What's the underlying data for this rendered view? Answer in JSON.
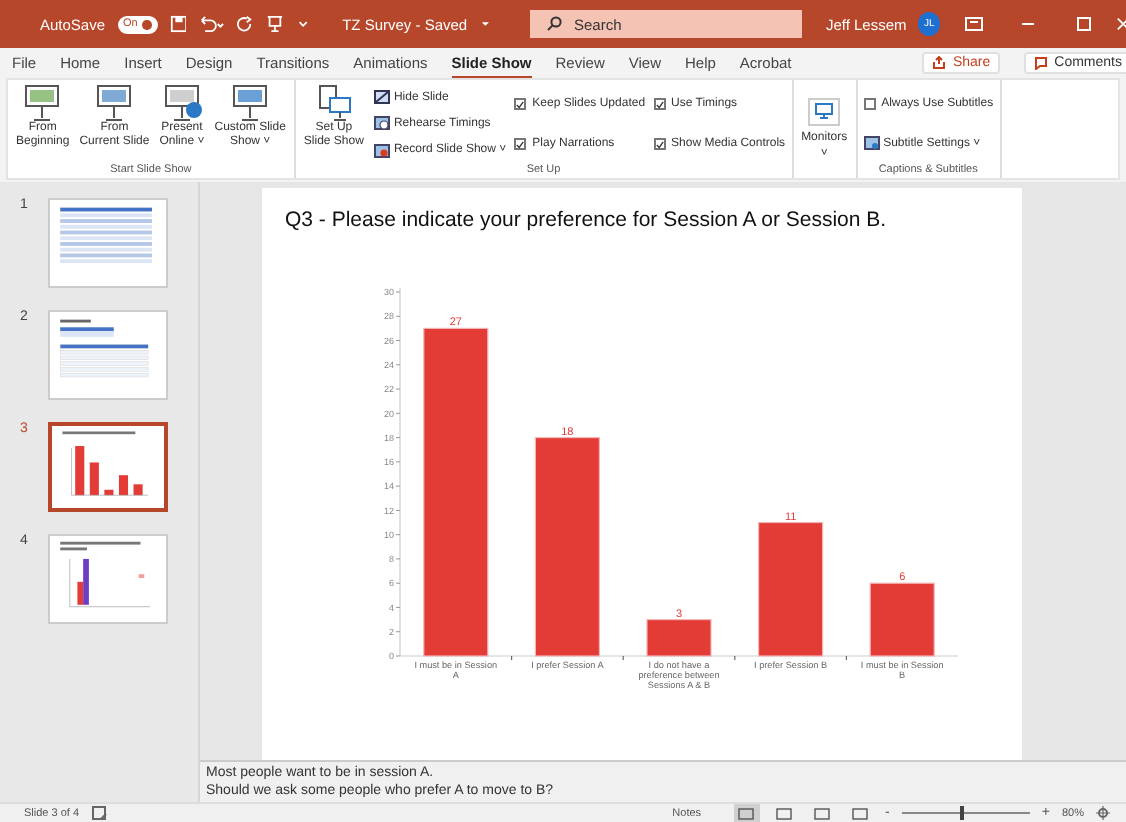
{
  "title_bar": {
    "autosave_label": "AutoSave",
    "autosave_toggle": {
      "text": "On",
      "on": true
    },
    "document_title": "TZ Survey - Saved",
    "search": {
      "placeholder": "Search"
    },
    "user_name": "Jeff Lessem",
    "avatar": "JL"
  },
  "tabs": [
    {
      "label": "File",
      "selected": false
    },
    {
      "label": "Home",
      "selected": false
    },
    {
      "label": "Insert",
      "selected": false
    },
    {
      "label": "Design",
      "selected": false
    },
    {
      "label": "Transitions",
      "selected": false
    },
    {
      "label": "Animations",
      "selected": false
    },
    {
      "label": "Slide Show",
      "selected": true
    },
    {
      "label": "Review",
      "selected": false
    },
    {
      "label": "View",
      "selected": false
    },
    {
      "label": "Help",
      "selected": false
    },
    {
      "label": "Acrobat",
      "selected": false
    }
  ],
  "tab_actions": {
    "share": "Share",
    "comments": "Comments"
  },
  "ribbon": {
    "start_group": {
      "label": "Start Slide Show",
      "buttons": [
        {
          "line1": "From",
          "line2": "Beginning"
        },
        {
          "line1": "From",
          "line2": "Current Slide"
        },
        {
          "line1": "Present",
          "line2": "Online ˅"
        },
        {
          "line1": "Custom Slide",
          "line2": "Show ˅"
        }
      ]
    },
    "setup_group": {
      "label": "Set Up",
      "setup_button": {
        "line1": "Set Up",
        "line2": "Slide Show"
      },
      "small_buttons": [
        "Hide Slide",
        "Rehearse Timings",
        "Record Slide Show  ˅"
      ],
      "checkboxes": [
        {
          "label": "Keep Slides Updated",
          "checked": true
        },
        {
          "label": "Play Narrations",
          "checked": true
        },
        {
          "label": "Use Timings",
          "checked": true
        },
        {
          "label": "Show Media Controls",
          "checked": true
        }
      ]
    },
    "monitors_button": {
      "label": "Monitors",
      "caret": "˅"
    },
    "captions_group": {
      "label": "Captions & Subtitles",
      "always_subtitles": {
        "label": "Always Use Subtitles",
        "checked": false
      },
      "subtitle_settings": "Subtitle Settings ˅"
    }
  },
  "thumbnails": [
    {
      "number": "1",
      "kind": "table",
      "selected": false
    },
    {
      "number": "2",
      "kind": "tables",
      "selected": false
    },
    {
      "number": "3",
      "kind": "bars",
      "selected": true
    },
    {
      "number": "4",
      "kind": "pair",
      "selected": false
    }
  ],
  "slide": {
    "title": "Q3 - Please indicate your preference for Session A or Session B.",
    "chart_data": {
      "type": "bar",
      "categories": [
        "I must be in Session A",
        "I prefer Session A",
        "I do not have a preference between Sessions A & B",
        "I prefer Session B",
        "I must be in Session B"
      ],
      "series": [
        {
          "color": "#e33b36",
          "values": [
            27,
            18,
            3,
            11,
            6
          ]
        }
      ],
      "ylim": [
        0,
        30
      ],
      "yticks": [
        0,
        2,
        4,
        6,
        8,
        10,
        12,
        14,
        16,
        18,
        20,
        22,
        24,
        26,
        28,
        30
      ],
      "data_labels": true
    }
  },
  "notes": [
    "Most people want to be in session A.",
    "Should we ask some people who prefer A to move to B?"
  ],
  "status_bar": {
    "slide_indicator": "Slide 3 of 4",
    "notes_button": "Notes",
    "views": [
      {
        "selected": true
      },
      {
        "selected": false
      },
      {
        "selected": false
      },
      {
        "selected": false
      }
    ],
    "zoom_minus": "-",
    "zoom_plus": "+",
    "zoom": {
      "level": 0.45
    },
    "zoom_text": "80%"
  }
}
